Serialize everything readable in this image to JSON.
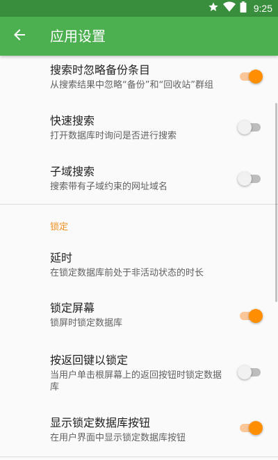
{
  "status_bar": {
    "time": "9:25",
    "icons": [
      "star-icon",
      "wifi-icon",
      "battery-icon"
    ],
    "color": "#388e3c"
  },
  "app_bar": {
    "title": "应用设置",
    "back_icon": "arrow-back-icon",
    "color": "#4caf50"
  },
  "accent_color": "#ff8f00",
  "settings": [
    {
      "title": "搜索时忽略备份条目",
      "summary": "从搜索结果中忽略“备份”和“回收站”群组",
      "switch_on": true
    },
    {
      "title": "快速搜索",
      "summary": "打开数据库时询问是否进行搜索",
      "switch_on": false
    },
    {
      "title": "子域搜索",
      "summary": "搜索带有子域约束的网址域名",
      "switch_on": false
    }
  ],
  "lock_section": {
    "header": "锁定",
    "items": [
      {
        "title": "延时",
        "summary": "在锁定数据库前处于非活动状态的时长"
      },
      {
        "title": "锁定屏幕",
        "summary": "锁屏时锁定数据库",
        "switch_on": true
      },
      {
        "title": "按返回键以锁定",
        "summary": "当用户单击根屏幕上的返回按钮时锁定数据库",
        "switch_on": false
      },
      {
        "title": "显示锁定数据库按钮",
        "summary": "在用户界面中显示锁定数据库按钮",
        "switch_on": true
      }
    ]
  }
}
